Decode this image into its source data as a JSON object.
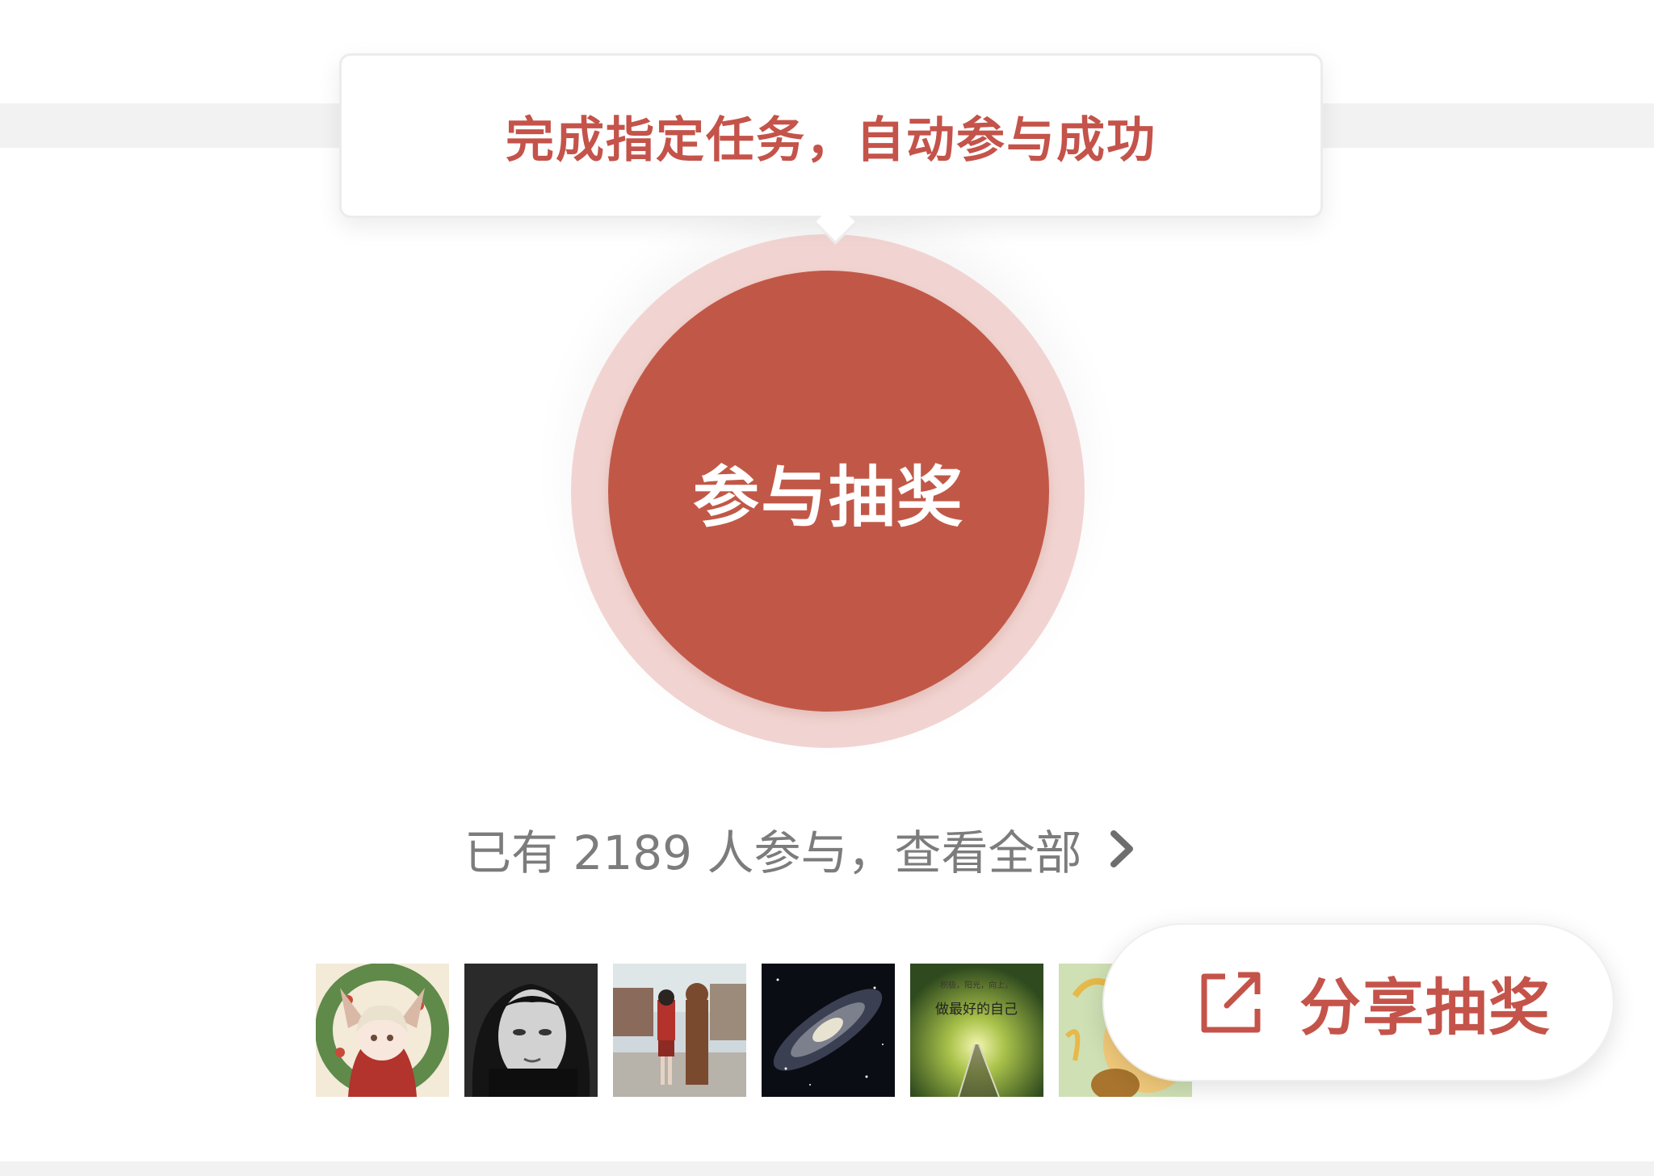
{
  "tooltip": {
    "text": "完成指定任务，自动参与成功"
  },
  "main_button": {
    "label": "参与抽奖"
  },
  "participants": {
    "text": "已有 2189 人参与，查看全部",
    "icon": "chevron-right-icon"
  },
  "avatars": [
    {
      "name": "avatar-anime-wreath"
    },
    {
      "name": "avatar-bw-portrait"
    },
    {
      "name": "avatar-couple-outdoors"
    },
    {
      "name": "avatar-galaxy"
    },
    {
      "name": "avatar-railway-sunrise",
      "text_line1": "积极，阳光，向上，",
      "text_line2": "做最好的自己"
    },
    {
      "name": "avatar-cartoon"
    }
  ],
  "share_button": {
    "label": "分享抽奖",
    "icon": "share-icon"
  },
  "colors": {
    "accent": "#c4534a",
    "button_fill": "#c15847",
    "halo": "#f1d4d1",
    "muted_text": "#7c7c7c",
    "band": "#f2f2f2"
  }
}
